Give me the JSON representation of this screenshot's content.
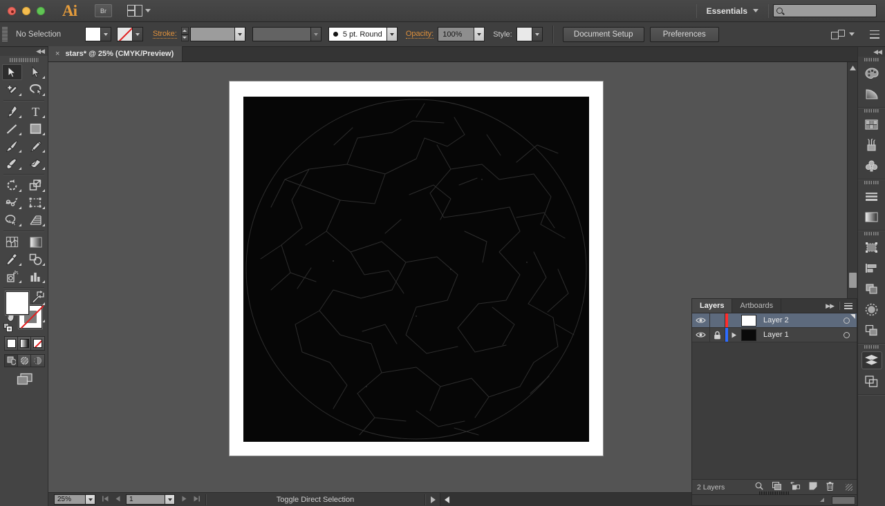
{
  "window": {
    "app_name": "Ai",
    "bridge_button": "Br",
    "workspace": "Essentials",
    "search_placeholder": "",
    "traffic_lights": [
      "close",
      "minimize",
      "maximize"
    ]
  },
  "control_bar": {
    "selection_status": "No Selection",
    "fill_label": "fill-swatch",
    "stroke_swatch_label": "stroke-swatch-none",
    "stroke_label": "Stroke:",
    "stroke_weight": "",
    "stroke_profile": "",
    "stroke_brush": "5 pt. Round",
    "opacity_label": "Opacity:",
    "opacity_value": "100%",
    "style_label": "Style:",
    "document_setup": "Document Setup",
    "preferences": "Preferences"
  },
  "tools": {
    "collapse": "◀◀",
    "items": [
      {
        "name": "selection-tool",
        "selected": true
      },
      {
        "name": "direct-selection-tool",
        "selected": false
      },
      {
        "name": "magic-wand-tool",
        "selected": false
      },
      {
        "name": "lasso-tool",
        "selected": false
      },
      {
        "name": "pen-tool",
        "selected": false
      },
      {
        "name": "type-tool",
        "selected": false
      },
      {
        "name": "line-segment-tool",
        "selected": false
      },
      {
        "name": "rectangle-tool",
        "selected": false
      },
      {
        "name": "paintbrush-tool",
        "selected": false
      },
      {
        "name": "pencil-tool",
        "selected": false
      },
      {
        "name": "blob-brush-tool",
        "selected": false
      },
      {
        "name": "eraser-tool",
        "selected": false
      },
      {
        "name": "rotate-tool",
        "selected": false
      },
      {
        "name": "scale-tool",
        "selected": false
      },
      {
        "name": "width-tool",
        "selected": false
      },
      {
        "name": "free-transform-tool",
        "selected": false
      },
      {
        "name": "shape-builder-tool",
        "selected": false
      },
      {
        "name": "perspective-grid-tool",
        "selected": false
      },
      {
        "name": "mesh-tool",
        "selected": false
      },
      {
        "name": "gradient-tool",
        "selected": false
      },
      {
        "name": "eyedropper-tool",
        "selected": false
      },
      {
        "name": "blend-tool",
        "selected": false
      },
      {
        "name": "symbol-sprayer-tool",
        "selected": false
      },
      {
        "name": "column-graph-tool",
        "selected": false
      },
      {
        "name": "artboard-tool",
        "selected": false
      },
      {
        "name": "slice-tool",
        "selected": false
      },
      {
        "name": "hand-tool",
        "selected": false
      },
      {
        "name": "zoom-tool",
        "selected": false
      }
    ],
    "fill_color": "#ffffff",
    "stroke_color": "#ffffff",
    "fill_stroke_modes": [
      "color-mode",
      "gradient-mode",
      "none-mode"
    ],
    "draw_modes": [
      "draw-normal",
      "draw-behind",
      "draw-inside"
    ],
    "screen_mode": "change-screen-mode"
  },
  "document": {
    "tab_title": "stars* @ 25% (CMYK/Preview)",
    "close_glyph": "×"
  },
  "canvas": {
    "artwork_background": "#060606",
    "artwork_line_color": "#2e2e2e",
    "page_background": "#ffffff"
  },
  "status_bar": {
    "zoom_level": "25%",
    "page_number": "1",
    "status_text": "Toggle Direct Selection"
  },
  "layers_panel": {
    "tabs": [
      {
        "label": "Layers",
        "active": true
      },
      {
        "label": "Artboards",
        "active": false
      }
    ],
    "expand_glyph": "▶▶",
    "rows": [
      {
        "name": "Layer 2",
        "visible": true,
        "locked": false,
        "selected": true,
        "color": "#ff2d2d",
        "thumb_color": "#ffffff",
        "has_disclosure": false
      },
      {
        "name": "Layer 1",
        "visible": true,
        "locked": true,
        "selected": false,
        "color": "#2d6cff",
        "thumb_color": "#0a0a0a",
        "has_disclosure": true
      }
    ],
    "footer_count": "2 Layers",
    "footer_icons": [
      "locate-object-icon",
      "make-clipping-mask-icon",
      "create-new-sublayer-icon",
      "create-new-layer-icon",
      "delete-selection-icon"
    ]
  },
  "right_dock": {
    "collapse": "◀◀",
    "groups": [
      [
        "color-panel-icon",
        "color-guide-panel-icon"
      ],
      [
        "swatches-panel-icon",
        "brushes-panel-icon",
        "symbols-panel-icon"
      ],
      [
        "stroke-panel-icon",
        "gradient-panel-icon"
      ],
      [
        "transform-panel-icon",
        "align-panel-icon",
        "pathfinder-panel-icon",
        "transparency-panel-icon",
        "appearance-panel-icon"
      ],
      [
        "layers-panel-icon",
        "artboards-panel-icon"
      ]
    ],
    "active_icon": "layers-panel-icon"
  },
  "colors": {
    "chrome": "#3f3f3f",
    "accent_link": "#e0913c",
    "panel_bg": "#484848",
    "selection_row": "#5d6a7d"
  }
}
